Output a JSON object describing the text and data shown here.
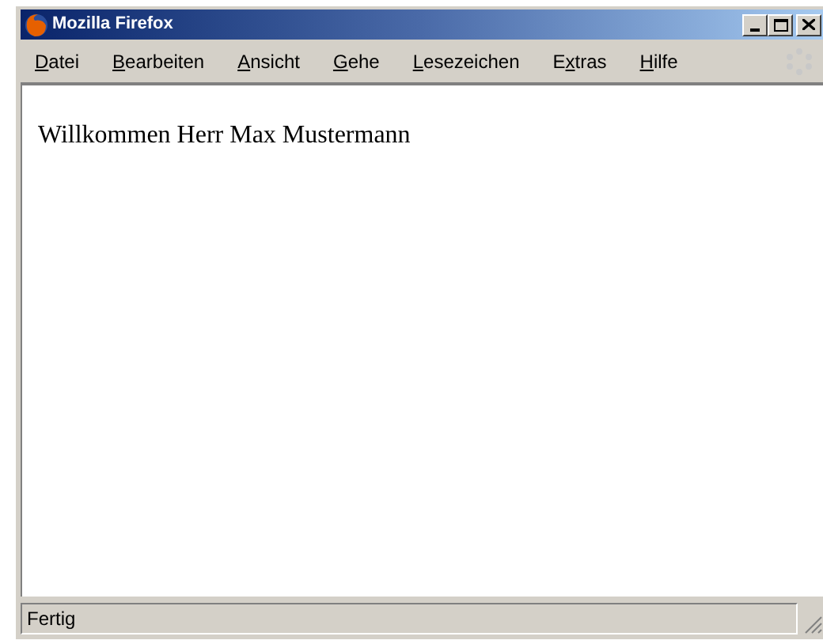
{
  "window": {
    "title": "Mozilla Firefox"
  },
  "menu": [
    {
      "access_key": "D",
      "after": "atei"
    },
    {
      "access_key": "B",
      "after": "earbeiten"
    },
    {
      "access_key": "A",
      "after": "nsicht"
    },
    {
      "access_key": "G",
      "after": "ehe"
    },
    {
      "access_key": "L",
      "after": "esezeichen"
    },
    {
      "before": "E",
      "access_key": "x",
      "after": "tras"
    },
    {
      "access_key": "H",
      "after": "ilfe"
    }
  ],
  "content": {
    "text": "Willkommen Herr Max Mustermann"
  },
  "status_bar": {
    "text": "Fertig"
  }
}
